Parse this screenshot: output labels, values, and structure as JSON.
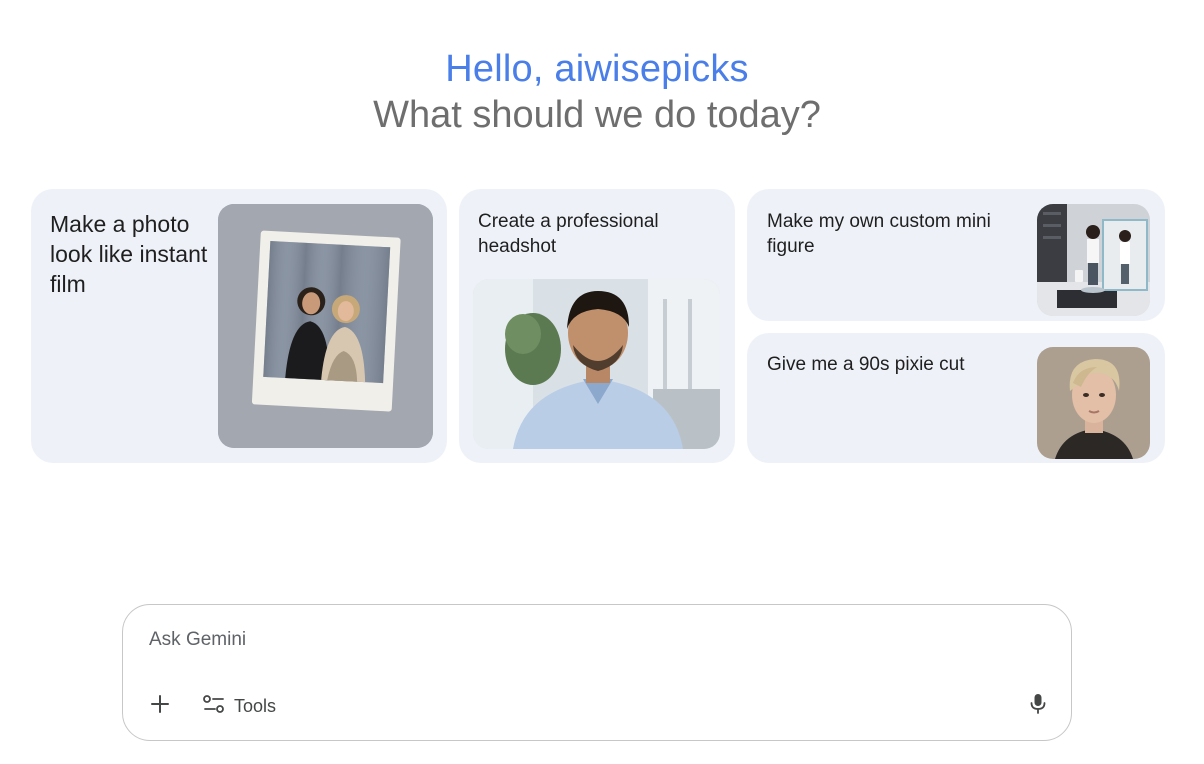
{
  "greeting": {
    "hello": "Hello, aiwisepicks",
    "question": "What should we do today?"
  },
  "cards": [
    {
      "label": "Make a photo look like instant film",
      "image_icon": "polaroid-photo-image"
    },
    {
      "label": "Create a professional headshot",
      "image_icon": "headshot-photo-image"
    },
    {
      "label": "Make my own custom mini figure",
      "image_icon": "mini-figure-image"
    },
    {
      "label": "Give me a 90s pixie cut",
      "image_icon": "pixie-cut-portrait-image"
    }
  ],
  "input": {
    "placeholder": "Ask Gemini",
    "tools_label": "Tools",
    "plus_icon": "plus-icon",
    "tools_icon": "tools-icon",
    "mic_icon": "microphone-icon"
  },
  "colors": {
    "accent": "#4a7ee8",
    "card_bg": "#eef2f8",
    "muted_text": "#6e6e6e"
  }
}
